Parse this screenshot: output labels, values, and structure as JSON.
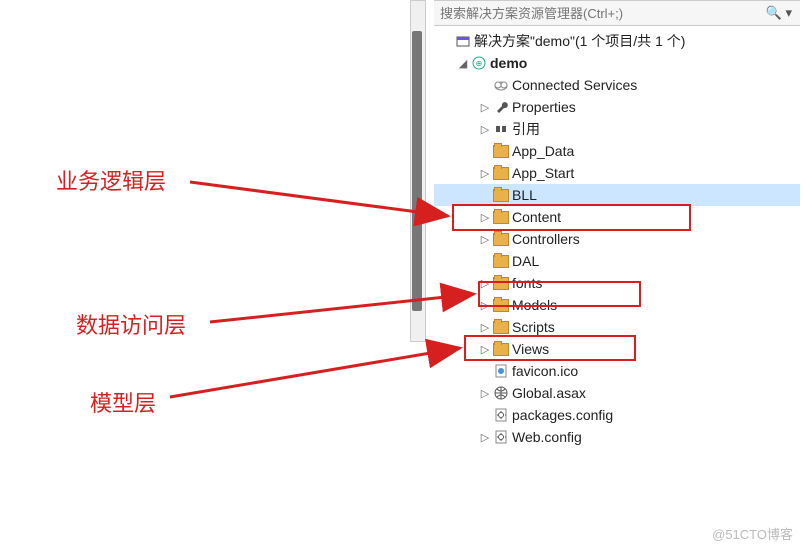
{
  "search": {
    "placeholder": "搜索解决方案资源管理器(Ctrl+;)"
  },
  "solution": {
    "label": "解决方案\"demo\"(1 个项目/共 1 个)"
  },
  "project": {
    "label": "demo"
  },
  "items": [
    {
      "label": "Connected Services",
      "icon": "cloud",
      "expander": ""
    },
    {
      "label": "Properties",
      "icon": "wrench",
      "expander": "▷"
    },
    {
      "label": "引用",
      "icon": "ref",
      "expander": "▷"
    },
    {
      "label": "App_Data",
      "icon": "folder",
      "expander": ""
    },
    {
      "label": "App_Start",
      "icon": "folder",
      "expander": "▷"
    },
    {
      "label": "BLL",
      "icon": "folder",
      "expander": "",
      "selected": true
    },
    {
      "label": "Content",
      "icon": "folder",
      "expander": "▷"
    },
    {
      "label": "Controllers",
      "icon": "folder",
      "expander": "▷"
    },
    {
      "label": "DAL",
      "icon": "folder",
      "expander": ""
    },
    {
      "label": "fonts",
      "icon": "folder",
      "expander": "▷"
    },
    {
      "label": "Models",
      "icon": "folder",
      "expander": "▷"
    },
    {
      "label": "Scripts",
      "icon": "folder",
      "expander": "▷"
    },
    {
      "label": "Views",
      "icon": "folder",
      "expander": "▷"
    },
    {
      "label": "favicon.ico",
      "icon": "file",
      "expander": ""
    },
    {
      "label": "Global.asax",
      "icon": "globe",
      "expander": "▷"
    },
    {
      "label": "packages.config",
      "icon": "config",
      "expander": ""
    },
    {
      "label": "Web.config",
      "icon": "config",
      "expander": "▷"
    }
  ],
  "annotations": {
    "bll": "业务逻辑层",
    "dal": "数据访问层",
    "models": "模型层"
  },
  "watermark": "@51CTO博客"
}
